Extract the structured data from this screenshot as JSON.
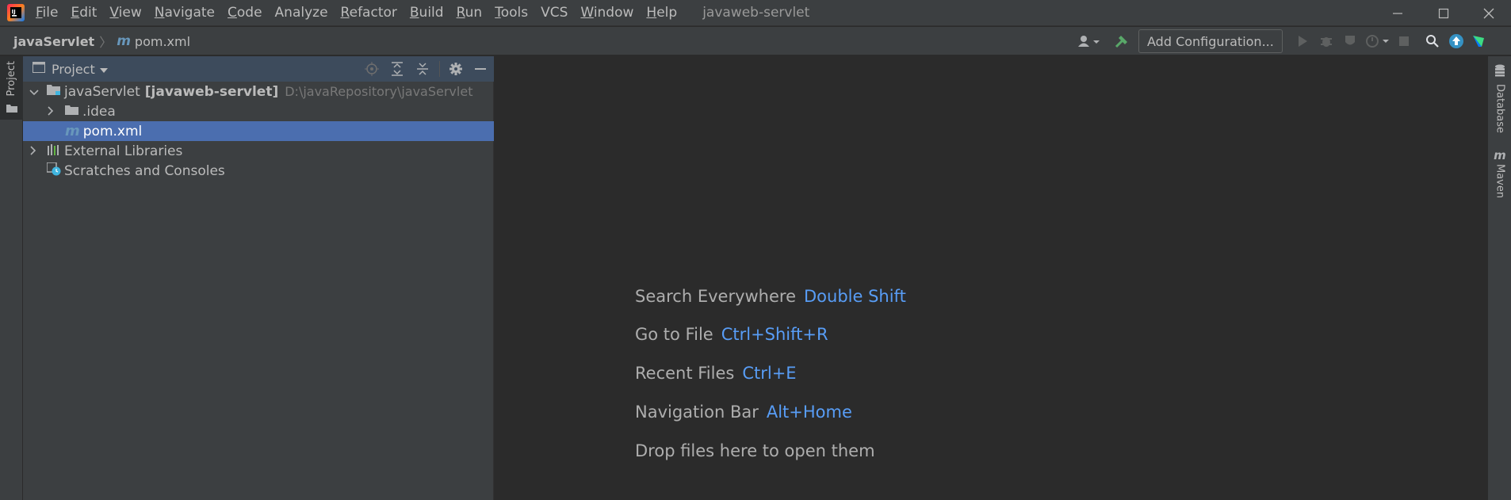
{
  "titlebar": {
    "menu": [
      {
        "label": "File",
        "mnemonic": "F",
        "rest": "ile"
      },
      {
        "label": "Edit",
        "mnemonic": "E",
        "rest": "dit"
      },
      {
        "label": "View",
        "mnemonic": "V",
        "rest": "iew"
      },
      {
        "label": "Navigate",
        "mnemonic": "N",
        "rest": "avigate"
      },
      {
        "label": "Code",
        "mnemonic": "C",
        "rest": "ode"
      },
      {
        "label": "Analyze",
        "mnemonic": "",
        "rest": "Analyze"
      },
      {
        "label": "Refactor",
        "mnemonic": "R",
        "rest": "efactor"
      },
      {
        "label": "Build",
        "mnemonic": "B",
        "rest": "uild"
      },
      {
        "label": "Run",
        "mnemonic": "R",
        "rest": "un"
      },
      {
        "label": "Tools",
        "mnemonic": "T",
        "rest": "ools"
      },
      {
        "label": "VCS",
        "mnemonic": "",
        "rest": "VCS"
      },
      {
        "label": "Window",
        "mnemonic": "W",
        "rest": "indow"
      },
      {
        "label": "Help",
        "mnemonic": "H",
        "rest": "elp"
      }
    ],
    "window_title": "javaweb-servlet"
  },
  "navbar": {
    "breadcrumb_project": "javaServlet",
    "breadcrumb_file": "pom.xml",
    "add_configuration": "Add Configuration..."
  },
  "left_stripe": {
    "project_tab": "Project"
  },
  "project_panel": {
    "header_label": "Project",
    "tree": {
      "root_name": "javaServlet",
      "root_module": "[javaweb-servlet]",
      "root_path": "D:\\javaRepository\\javaServlet",
      "idea": ".idea",
      "pom": "pom.xml",
      "external_libraries": "External Libraries",
      "scratches": "Scratches and Consoles"
    }
  },
  "right_stripe": {
    "database_tab": "Database",
    "maven_tab": "Maven"
  },
  "editor_hints": [
    {
      "label": "Search Everywhere",
      "key": "Double Shift"
    },
    {
      "label": "Go to File",
      "key": "Ctrl+Shift+R"
    },
    {
      "label": "Recent Files",
      "key": "Ctrl+E"
    },
    {
      "label": "Navigation Bar",
      "key": "Alt+Home"
    },
    {
      "label": "Drop files here to open them",
      "key": ""
    }
  ],
  "colors": {
    "accent_key": "#589df6",
    "selection": "#4b6eaf",
    "panel_bg": "#3c3f41",
    "editor_bg": "#2b2b2b"
  }
}
